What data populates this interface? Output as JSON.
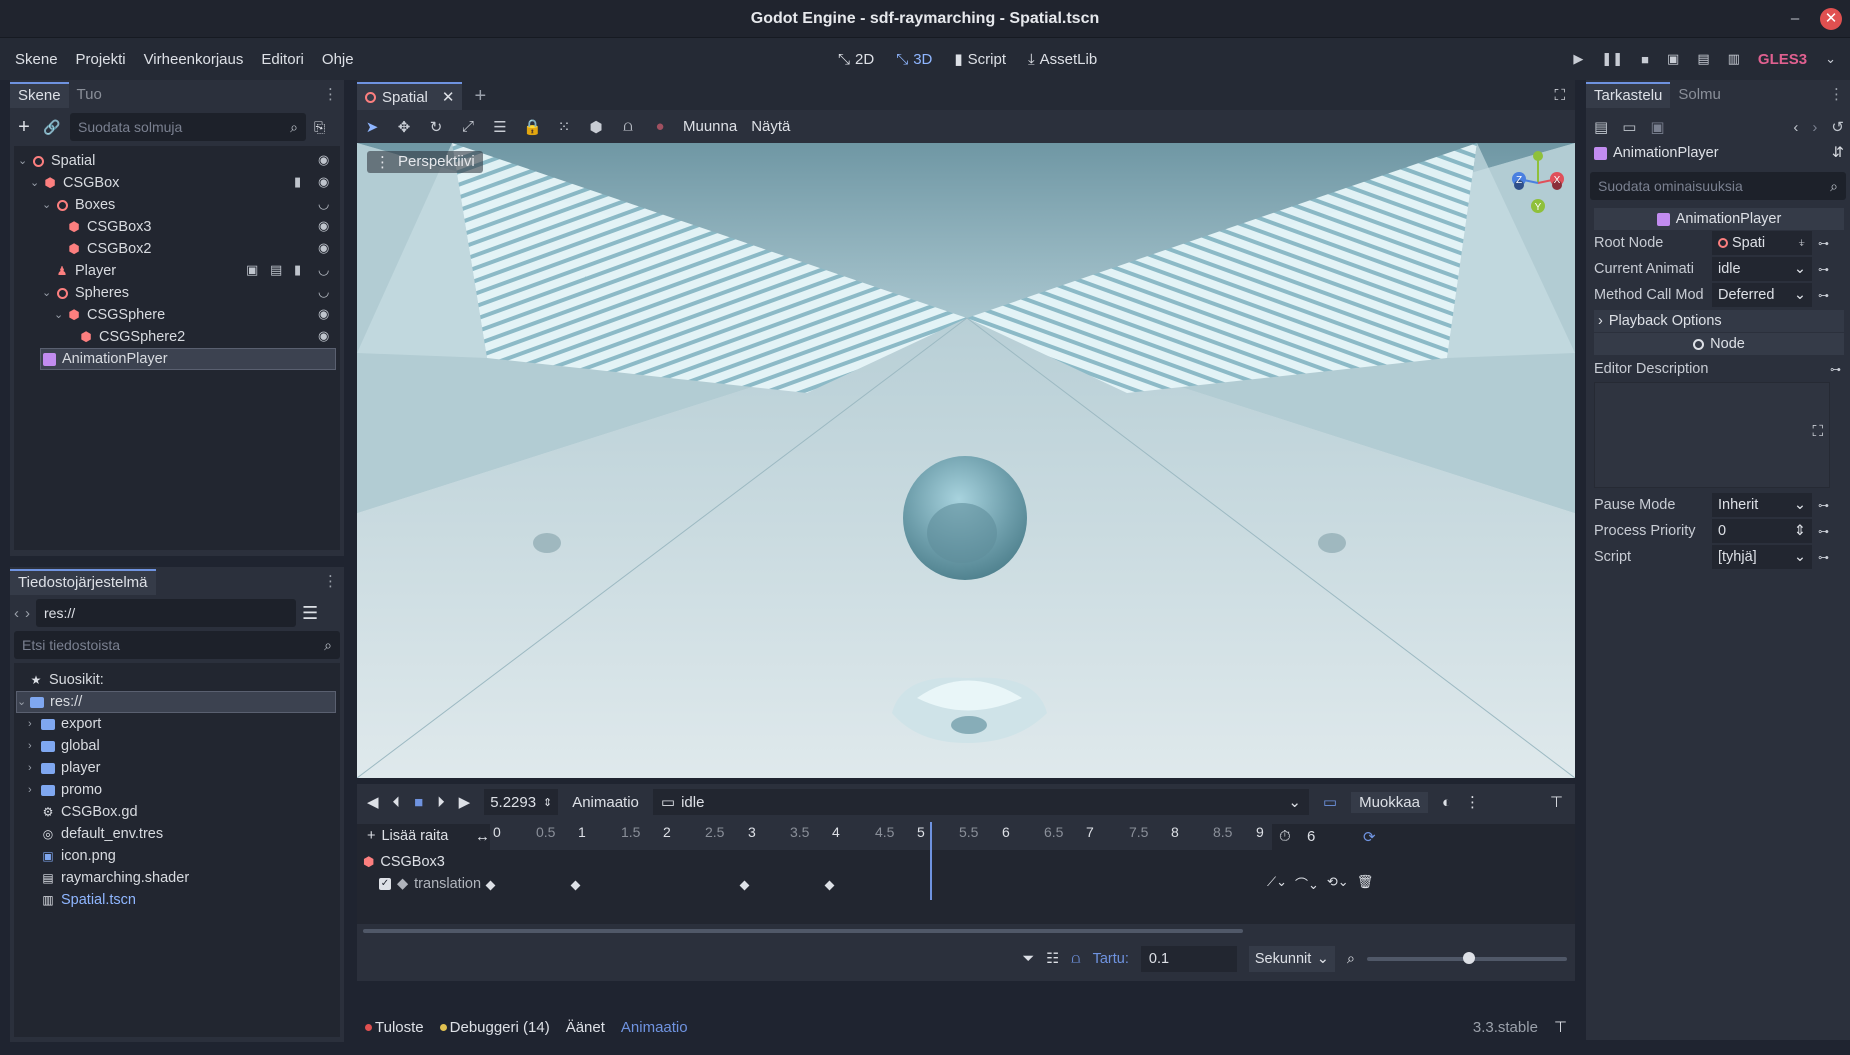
{
  "window": {
    "title": "Godot Engine - sdf-raymarching - Spatial.tscn"
  },
  "menu": {
    "items": [
      "Skene",
      "Projekti",
      "Virheenkorjaus",
      "Editori",
      "Ohje"
    ]
  },
  "workspaces": {
    "2d": "2D",
    "3d": "3D",
    "script": "Script",
    "assetlib": "AssetLib"
  },
  "renderer": "GLES3",
  "scene_dock": {
    "tab_active": "Skene",
    "tab_other": "Tuo",
    "filter_placeholder": "Suodata solmuja",
    "nodes": [
      {
        "label": "Spatial"
      },
      {
        "label": "CSGBox"
      },
      {
        "label": "Boxes"
      },
      {
        "label": "CSGBox3"
      },
      {
        "label": "CSGBox2"
      },
      {
        "label": "Player"
      },
      {
        "label": "Spheres"
      },
      {
        "label": "CSGSphere"
      },
      {
        "label": "CSGSphere2"
      },
      {
        "label": "AnimationPlayer"
      }
    ]
  },
  "filesystem": {
    "tab": "Tiedostojärjestelmä",
    "path": "res://",
    "search_placeholder": "Etsi tiedostoista",
    "items": [
      {
        "label": "Suosikit:"
      },
      {
        "label": "res://"
      },
      {
        "label": "export"
      },
      {
        "label": "global"
      },
      {
        "label": "player"
      },
      {
        "label": "promo"
      },
      {
        "label": "CSGBox.gd"
      },
      {
        "label": "default_env.tres"
      },
      {
        "label": "icon.png"
      },
      {
        "label": "raymarching.shader"
      },
      {
        "label": "Spatial.tscn"
      }
    ]
  },
  "editor_tab": {
    "label": "Spatial"
  },
  "viewport_toolbar": {
    "transform": "Muunna",
    "view": "Näytä",
    "perspective": "Perspektiivi"
  },
  "gizmo": {
    "x": "X",
    "y": "Y",
    "z": "Z"
  },
  "animation": {
    "time": "5.2293",
    "animation_label": "Animaatio",
    "current": "idle",
    "edit": "Muokkaa",
    "add_track": "Lisää raita",
    "ruler": [
      "0",
      "0.5",
      "1",
      "1.5",
      "2",
      "2.5",
      "3",
      "3.5",
      "4",
      "4.5",
      "5",
      "5.5",
      "6",
      "6.5",
      "7",
      "7.5",
      "8",
      "8.5",
      "9"
    ],
    "length": "6",
    "track_node": "CSGBox3",
    "track_property": "translation",
    "keys": [
      0,
      1,
      3,
      4
    ],
    "snap_label": "Tartu:",
    "snap_value": "0.1",
    "snap_unit": "Sekunnit"
  },
  "bottom_tabs": {
    "output": "Tuloste",
    "debugger": "Debuggeri (14)",
    "audio": "Äänet",
    "animation": "Animaatio",
    "version": "3.3.stable"
  },
  "inspector": {
    "tab_active": "Tarkastelu",
    "tab_other": "Solmu",
    "object": "AnimationPlayer",
    "filter_placeholder": "Suodata ominaisuuksia",
    "section": "AnimationPlayer",
    "props": [
      {
        "label": "Root Node",
        "value": "Spati"
      },
      {
        "label": "Current Animati",
        "value": "idle"
      },
      {
        "label": "Method Call Mod",
        "value": "Deferred"
      }
    ],
    "playback_options": "Playback Options",
    "node_section": "Node",
    "editor_description": "Editor Description",
    "props2": [
      {
        "label": "Pause Mode",
        "value": "Inherit"
      },
      {
        "label": "Process Priority",
        "value": "0"
      },
      {
        "label": "Script",
        "value": "[tyhjä]"
      }
    ]
  }
}
